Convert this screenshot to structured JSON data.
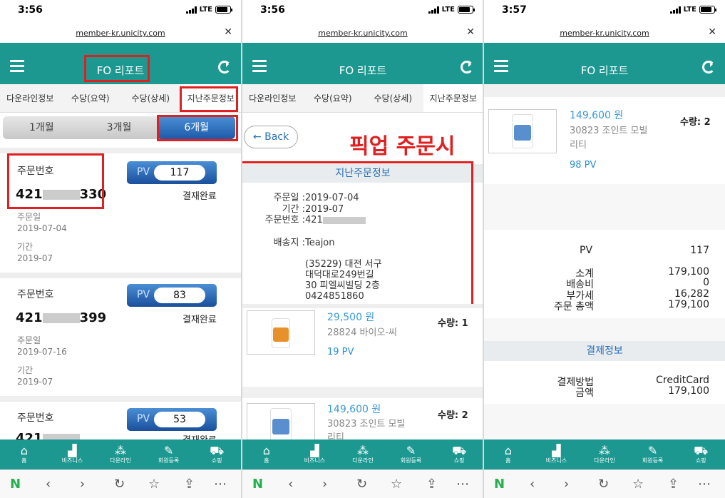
{
  "status_bar": [
    {
      "time": "3:56",
      "network": "LTE"
    },
    {
      "time": "3:56",
      "network": "LTE"
    },
    {
      "time": "3:57",
      "network": "LTE"
    }
  ],
  "url": "member-kr.unicity.com",
  "header_title": "FO 리포트",
  "tabs": [
    "다운라인정보",
    "수당(요약)",
    "수당(상세)",
    "지난주문정보"
  ],
  "periods": [
    "1개월",
    "3개월",
    "6개월"
  ],
  "order_number_label": "주문번호",
  "order_date_label": "주문일",
  "period_label": "기간",
  "pv_label": "PV",
  "orders": [
    {
      "num_prefix": "421",
      "num_suffix": "330",
      "pv": "117",
      "status": "결재완료",
      "date": "2019-07-04",
      "period": "2019-07"
    },
    {
      "num_prefix": "421",
      "num_suffix": "399",
      "pv": "83",
      "status": "결재완료",
      "date": "2019-07-16",
      "period": "2019-07"
    },
    {
      "num_prefix": "421",
      "num_suffix": "",
      "pv": "53",
      "status": "결재완료",
      "date": "",
      "period": ""
    }
  ],
  "detail": {
    "back_label": "← Back",
    "annotation": "픽업 주문시",
    "section_title": "지난주문정보",
    "order_date_label": "주문일 :",
    "order_date": "2019-07-04",
    "period_label": "기간 :",
    "period": "2019-07",
    "order_no_label": "주문번호 :",
    "order_no_prefix": "421",
    "ship_label": "배송지 :",
    "ship_name": "Teajon",
    "addr1": "(35229) 대전 서구",
    "addr2": "대덕대로249번길",
    "addr3": "30 피엘씨빌딩 2층",
    "phone": "0424851860"
  },
  "products": [
    {
      "price": "29,500 원",
      "name": "28824 바이오-씨",
      "pv": "19 PV",
      "qty": "수량: 1",
      "color": "#e8912a"
    },
    {
      "price": "149,600 원",
      "name": "30823 조인트 모빌 리티",
      "name_l1": "30823 조인트 모빌",
      "name_l2": "리티",
      "pv": "98 PV",
      "qty": "수량: 2",
      "color": "#5a8fcf"
    }
  ],
  "summary": {
    "pv_label": "PV",
    "pv_value": "117",
    "subtotal_label": "소계",
    "subtotal": "179,100",
    "shipping_label": "배송비",
    "shipping": "0",
    "tax_label": "부가세",
    "tax": "16,282",
    "total_label": "주문 총액",
    "total": "179,100",
    "payment_title": "결제정보",
    "method_label": "결제방법",
    "method": "CreditCard",
    "amount_label": "금액",
    "amount": "179,100"
  },
  "bottom_nav": [
    "홈",
    "비즈니스",
    "다운라인",
    "회원등록",
    "쇼핑"
  ],
  "bottom_nav_icons": [
    "home-icon",
    "chart-icon",
    "network-icon",
    "pencil-icon",
    "cart-icon"
  ],
  "browser_icons": [
    "naver-icon",
    "back-arrow-icon",
    "forward-arrow-icon",
    "reload-icon",
    "star-icon",
    "share-icon",
    "more-icon"
  ],
  "accent": "#1c9891",
  "highlight": "#e02020"
}
